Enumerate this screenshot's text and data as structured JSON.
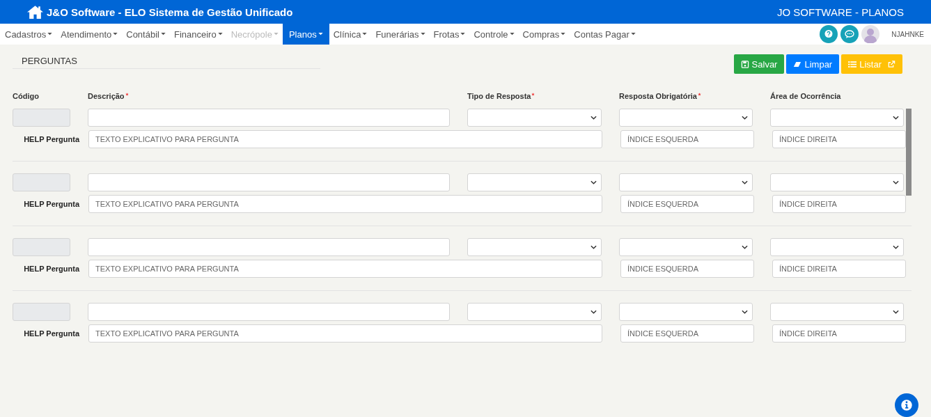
{
  "header": {
    "title": "J&O Software - ELO Sistema de Gestão Unificado",
    "module": "JO SOFTWARE - PLANOS"
  },
  "nav": {
    "items": [
      {
        "label": "Cadastros",
        "selected": false,
        "disabled": false
      },
      {
        "label": "Atendimento",
        "selected": false,
        "disabled": false
      },
      {
        "label": "Contábil",
        "selected": false,
        "disabled": false
      },
      {
        "label": "Financeiro",
        "selected": false,
        "disabled": false
      },
      {
        "label": "Necrópole",
        "selected": false,
        "disabled": true
      },
      {
        "label": "Planos",
        "selected": true,
        "disabled": false
      },
      {
        "label": "Clínica",
        "selected": false,
        "disabled": false
      },
      {
        "label": "Funerárias",
        "selected": false,
        "disabled": false
      },
      {
        "label": "Frotas",
        "selected": false,
        "disabled": false
      },
      {
        "label": "Controle",
        "selected": false,
        "disabled": false
      },
      {
        "label": "Compras",
        "selected": false,
        "disabled": false
      },
      {
        "label": "Contas Pagar",
        "selected": false,
        "disabled": false
      }
    ],
    "user": "NJAHNKE"
  },
  "page": {
    "title": "PERGUNTAS",
    "buttons": [
      {
        "label": "Salvar",
        "kind": "save"
      },
      {
        "label": "Limpar",
        "kind": "clear"
      },
      {
        "label": "Listar",
        "kind": "list"
      }
    ]
  },
  "columns": [
    {
      "label": "Código",
      "required": false
    },
    {
      "label": "Descrição",
      "required": true
    },
    {
      "label": "Tipo de Resposta",
      "required": true
    },
    {
      "label": "Resposta Obrigatória",
      "required": true
    },
    {
      "label": "Área de Ocorrência",
      "required": false
    }
  ],
  "rows": [
    {
      "help_label": "HELP Pergunta",
      "help_placeholder": "TEXTO EXPLICATIVO PARA PERGUNTA",
      "left_placeholder": "ÍNDICE ESQUERDA",
      "right_placeholder": "ÍNDICE DIREITA"
    },
    {
      "help_label": "HELP Pergunta",
      "help_placeholder": "TEXTO EXPLICATIVO PARA PERGUNTA",
      "left_placeholder": "ÍNDICE ESQUERDA",
      "right_placeholder": "ÍNDICE DIREITA"
    },
    {
      "help_label": "HELP Pergunta",
      "help_placeholder": "TEXTO EXPLICATIVO PARA PERGUNTA",
      "left_placeholder": "ÍNDICE ESQUERDA",
      "right_placeholder": "ÍNDICE DIREITA"
    },
    {
      "help_label": "HELP Pergunta",
      "help_placeholder": "TEXTO EXPLICATIVO PARA PERGUNTA",
      "left_placeholder": "ÍNDICE ESQUERDA",
      "right_placeholder": "ÍNDICE DIREITA"
    }
  ]
}
